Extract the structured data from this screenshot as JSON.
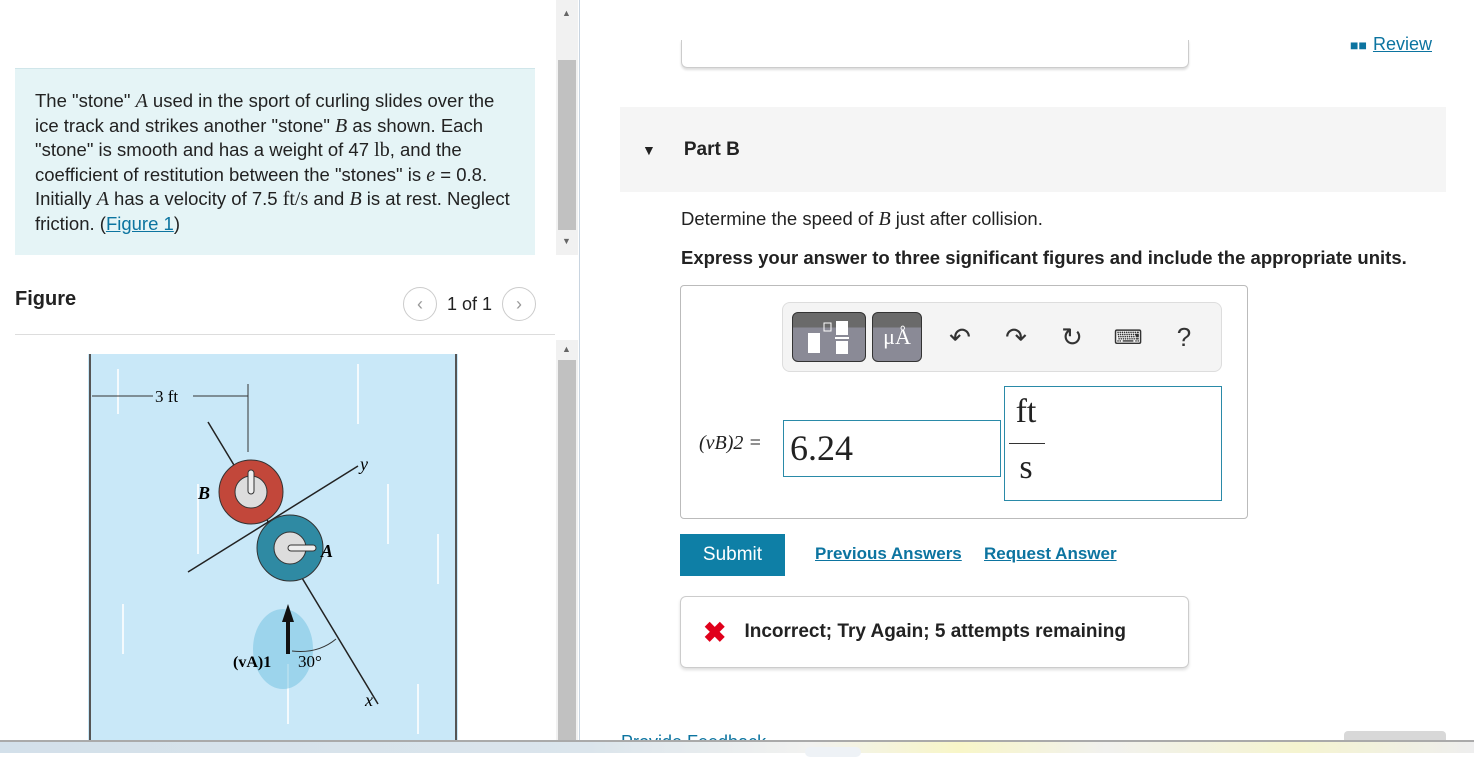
{
  "problem": {
    "text_1": "The \"stone\" ",
    "var_a": "A",
    "text_2": " used in the sport of curling slides over the ice track and strikes another \"stone\" ",
    "var_b": "B",
    "text_3": " as shown. Each \"stone\" is smooth and has a weight of 47 ",
    "unit_lb": "lb",
    "text_4": ", and the coefficient of restitution between the \"stones\" is ",
    "var_e": "e",
    "text_5": " = 0.8. Initially ",
    "text_6": " has a velocity of 7.5 ",
    "unit_fts": "ft/s",
    "text_7": " and ",
    "text_8": " is at rest. Neglect friction. (",
    "figure_link": "Figure 1",
    "text_9": ")"
  },
  "figure": {
    "title": "Figure",
    "pager": "1 of 1",
    "labels": {
      "dim": "3 ft",
      "b": "B",
      "a": "A",
      "y": "y",
      "x": "x",
      "velocity": "(vA)1",
      "angle": "30°"
    },
    "colors": {
      "ice": "#c9e8f8",
      "stone_b": "#c2473a",
      "stone_a": "#2f8aa3"
    }
  },
  "header": {
    "review": "Review"
  },
  "part": {
    "label": "Part B"
  },
  "question": {
    "text_1": "Determine the speed of ",
    "var": "B",
    "text_2": " just after collision."
  },
  "instructions": "Express your answer to three significant figures and include the appropriate units.",
  "answer": {
    "variable_label": "(vB)2 =",
    "value": "6.24",
    "unit_numerator": "ft",
    "unit_denominator": "s",
    "toolbar": [
      "fraction-template-icon",
      "units-icon",
      "undo-icon",
      "redo-icon",
      "reset-icon",
      "keyboard-icon",
      "help-icon"
    ],
    "units_button": "μÅ",
    "help": "?"
  },
  "actions": {
    "submit": "Submit",
    "previous": "Previous Answers",
    "request": "Request Answer"
  },
  "feedback": {
    "message": "Incorrect; Try Again; 5 attempts remaining",
    "color": "#e0001b"
  },
  "footer": {
    "provide_feedback": "Provide Feedback"
  },
  "colors": {
    "accent": "#0e7fa6",
    "link": "#0c74a0"
  }
}
